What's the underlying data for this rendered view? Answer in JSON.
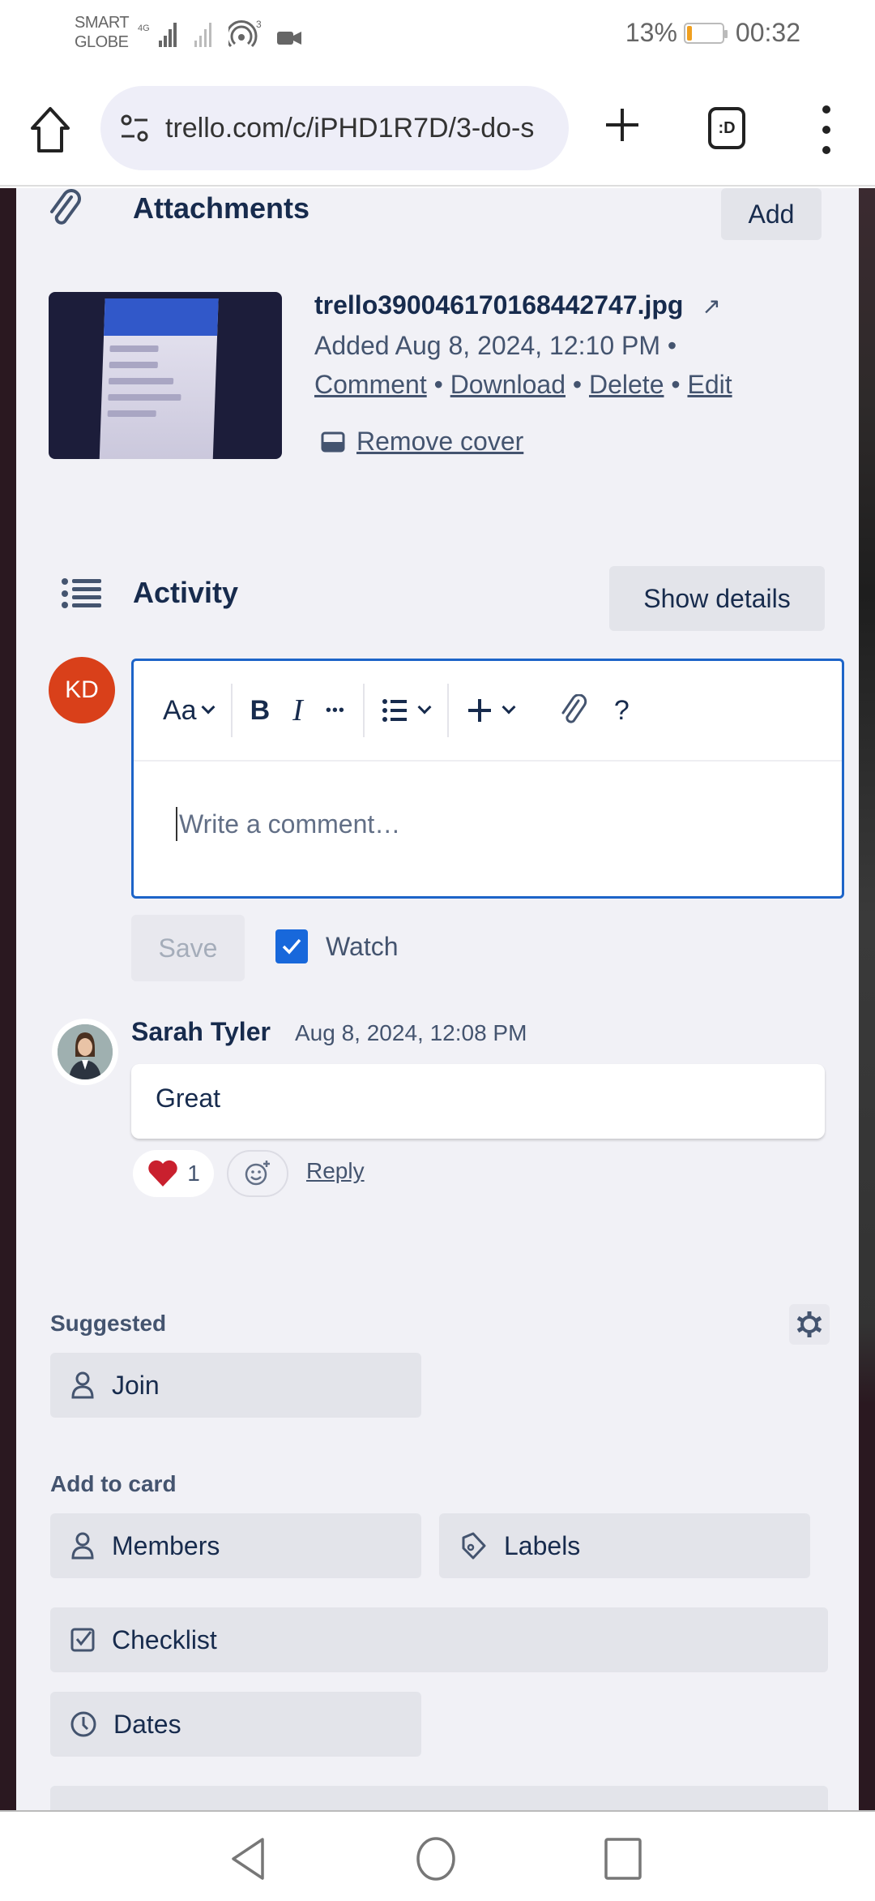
{
  "status_bar": {
    "carrier_line1": "SMART",
    "carrier_line2": "GLOBE",
    "network": "4G",
    "hotspot_count": "3",
    "battery_percent": "13%",
    "battery_level": 0.13,
    "time": "00:32"
  },
  "browser": {
    "url": "trello.com/c/iPHD1R7D/3-do-s",
    "tabs_label": ":D",
    "icons": [
      "home-icon",
      "site-settings-icon",
      "new-tab-icon",
      "tab-switcher-icon",
      "more-menu-icon"
    ]
  },
  "attachments": {
    "title": "Attachments",
    "add_label": "Add",
    "items": [
      {
        "filename": "trello390046170168442747.jpg",
        "open_icon": "↗",
        "added": "Added Aug 8, 2024, 12:10 PM •",
        "actions": [
          "Comment",
          "Download",
          "Delete",
          "Edit"
        ],
        "separator": " • ",
        "remove_cover": "Remove cover"
      }
    ]
  },
  "activity": {
    "title": "Activity",
    "show_details_label": "Show details",
    "current_user_initials": "KD",
    "editor": {
      "text_style_label": "Aa",
      "bold": "B",
      "italic": "I",
      "more": "•••",
      "help": "?",
      "placeholder": "Write a comment…",
      "value": ""
    },
    "save_label": "Save",
    "watch_label": "Watch",
    "watch_checked": true,
    "comments": [
      {
        "author": "Sarah Tyler",
        "timestamp": "Aug 8, 2024, 12:08 PM",
        "text": "Great",
        "reactions": [
          {
            "emoji": "heart",
            "count": "1"
          }
        ],
        "reply_label": "Reply"
      }
    ]
  },
  "suggested": {
    "title": "Suggested",
    "join_label": "Join"
  },
  "add_to_card": {
    "title": "Add to card",
    "members_label": "Members",
    "labels_label": "Labels",
    "checklist_label": "Checklist",
    "dates_label": "Dates"
  },
  "colors": {
    "accent": "#1868db",
    "avatar_kd": "#d9401a",
    "card_bg": "#f1f1f6",
    "button_bg": "#e3e4ea",
    "text_primary": "#172b4d",
    "heart": "#c9202e"
  }
}
